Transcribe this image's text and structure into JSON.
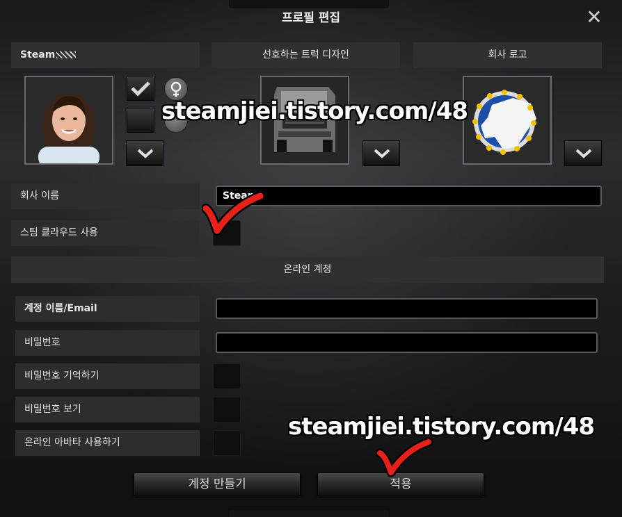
{
  "window": {
    "title": "프로필 편집",
    "close_icon": "close-icon"
  },
  "header": {
    "player_name": "Steam",
    "truck_design_label": "선호하는 트럭 디자인",
    "company_logo_label": "회사 로고"
  },
  "company": {
    "name_label": "회사 이름",
    "name_value": "Steam",
    "steam_cloud_label": "스팀 클라우드 사용"
  },
  "online": {
    "section_title": "온라인 계정",
    "account_label": "계정 이름/Email",
    "account_value": "",
    "password_label": "비밀번호",
    "password_value": "",
    "remember_label": "비밀번호 기억하기",
    "show_label": "비밀번호 보기",
    "avatar_label": "온라인 아바타 사용하기"
  },
  "buttons": {
    "create_account": "계정 만들기",
    "apply": "적용"
  },
  "watermark": {
    "text1": "steamjiei.tistory.com/48",
    "text2": "steamjiei.tistory.com/48"
  },
  "colors": {
    "checkmark": "#e8201a",
    "panel": "#303033",
    "field_bg": "#000000"
  }
}
